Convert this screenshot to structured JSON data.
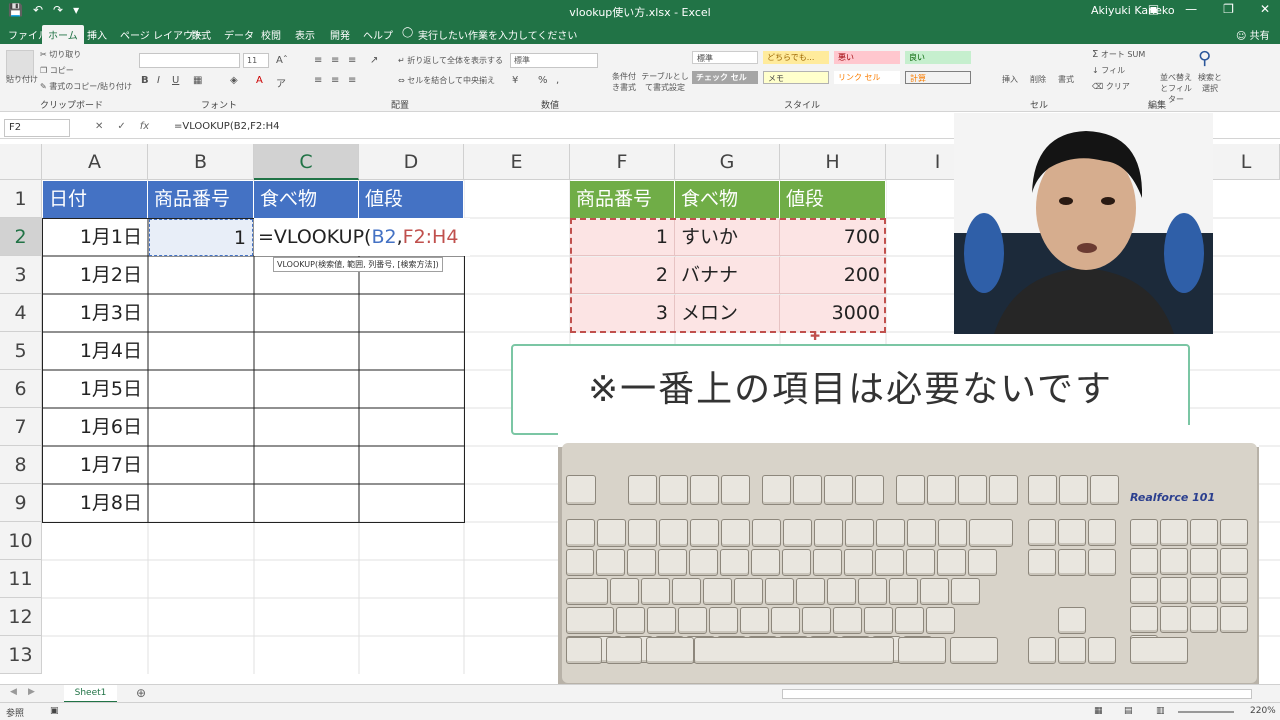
{
  "titlebar": {
    "filename": "vlookup使い方.xlsx - Excel",
    "user": "Akiyuki Kaneko"
  },
  "tabs": [
    "ファイル",
    "ホーム",
    "挿入",
    "ページ レイアウト",
    "数式",
    "データ",
    "校閲",
    "表示",
    "開発",
    "ヘルプ"
  ],
  "tellme": "実行したい作業を入力してください",
  "share": "共有",
  "ribbon": {
    "groups": [
      "クリップボード",
      "フォント",
      "配置",
      "数値",
      "スタイル",
      "セル",
      "編集"
    ],
    "paste": "貼り付け",
    "cut": "切り取り",
    "copy": "コピー",
    "format_painter": "書式のコピー/貼り付け",
    "font_size": "11",
    "wrap": "折り返して全体を表示する",
    "merge": "セルを結合して中央揃え",
    "number_format": "標準",
    "cond_format": "条件付き書式",
    "table_format": "テーブルとして書式設定",
    "styles": [
      "標準",
      "どちらでも...",
      "悪い",
      "良い",
      "チェック セル",
      "メモ",
      "リンク セル",
      "計算"
    ],
    "insert": "挿入",
    "delete": "削除",
    "format": "書式",
    "autosum": "オート SUM",
    "fill": "フィル",
    "clear": "クリア",
    "sort": "並べ替えとフィルター",
    "find": "検索と選択"
  },
  "formula_bar": {
    "name_box": "F2",
    "formula": "=VLOOKUP(B2,F2:H4"
  },
  "columns": [
    "A",
    "B",
    "C",
    "D",
    "E",
    "F",
    "G",
    "H",
    "I",
    "L"
  ],
  "rows": [
    "1",
    "2",
    "3",
    "4",
    "5",
    "6",
    "7",
    "8",
    "9",
    "10",
    "11",
    "12",
    "13"
  ],
  "table1": {
    "headers": [
      "日付",
      "商品番号",
      "食べ物",
      "値段"
    ],
    "dates": [
      "1月1日",
      "1月2日",
      "1月3日",
      "1月4日",
      "1月5日",
      "1月6日",
      "1月7日",
      "1月8日"
    ],
    "b2": "1",
    "c2_prefix": "=VLOOKUP(",
    "c2_ref1": "B2",
    "c2_comma": ",",
    "c2_ref2": "F2:H4"
  },
  "tooltip": "VLOOKUP(検索値, 範囲, 列番号, [検索方法])",
  "table2": {
    "headers": [
      "商品番号",
      "食べ物",
      "値段"
    ],
    "rows": [
      {
        "id": "1",
        "food": "すいか",
        "price": "700"
      },
      {
        "id": "2",
        "food": "バナナ",
        "price": "200"
      },
      {
        "id": "3",
        "food": "メロン",
        "price": "3000"
      }
    ]
  },
  "callout": "※一番上の項目は必要ないです",
  "keyboard_brand": "Realforce 101",
  "sheet_tab": "Sheet1",
  "status": "参照",
  "zoom": "220%",
  "colors": {
    "excel_green": "#217346",
    "header_blue": "#4472c4",
    "header_green": "#70ad47",
    "pink_fill": "#fce4e4",
    "ref_blue": "#4472c4",
    "ref_red": "#c0504d"
  }
}
